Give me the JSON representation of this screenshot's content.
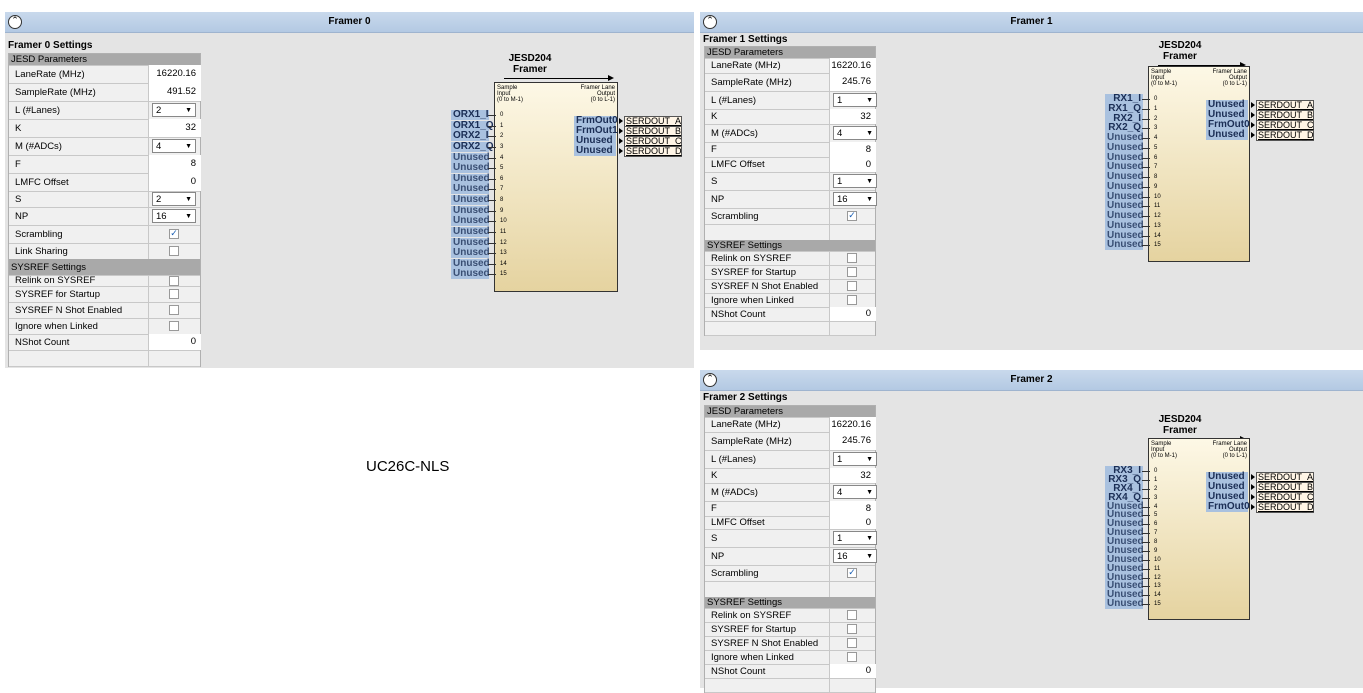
{
  "label": "UC26C-NLS",
  "rows_common": [
    "JESD Parameters",
    "LaneRate (MHz)",
    "SampleRate (MHz)",
    "L (#Lanes)",
    "K",
    "M (#ADCs)",
    "F",
    "LMFC Offset",
    "S",
    "NP",
    "Scrambling"
  ],
  "jesd_title": [
    "JESD204",
    "Framer"
  ],
  "box_header": {
    "left": "Sample\nInput\n(0 to M-1)",
    "right": "Framer Lane\nOutput\n(0 to L-1)"
  },
  "serdout": [
    "SERDOUT_A",
    "SERDOUT_B",
    "SERDOUT_C",
    "SERDOUT_D"
  ],
  "framers": [
    {
      "title": "Framer 0",
      "settings_title": "Framer 0 Settings",
      "params": {
        "lanerate": "16220.16",
        "samplerate": "491.52",
        "L": "2",
        "K": "32",
        "M": "4",
        "F": "8",
        "lmfc": "0",
        "S": "2",
        "NP": "16"
      },
      "scrambling": true,
      "link_sharing_label": "Link Sharing",
      "link_sharing": false,
      "sysref": {
        "section": "SYSREF Settings",
        "relink": "Relink on SYSREF",
        "startup": "SYSREF for Startup",
        "nshot_enabled": "SYSREF N Shot Enabled",
        "ignore": "Ignore when Linked",
        "nshot_count_label": "NShot Count",
        "nshot_count": "0"
      },
      "inputs": [
        "ORX1_I",
        "ORX1_Q",
        "ORX2_I",
        "ORX2_Q",
        "Unused",
        "Unused",
        "Unused",
        "Unused",
        "Unused",
        "Unused",
        "Unused",
        "Unused",
        "Unused",
        "Unused",
        "Unused",
        "Unused"
      ],
      "outputs": [
        "FrmOut0",
        "FrmOut1",
        "Unused",
        "Unused"
      ]
    },
    {
      "title": "Framer 1",
      "settings_title": "Framer 1 Settings",
      "params": {
        "lanerate": "16220.16",
        "samplerate": "245.76",
        "L": "1",
        "K": "32",
        "M": "4",
        "F": "8",
        "lmfc": "0",
        "S": "1",
        "NP": "16"
      },
      "scrambling": true,
      "sysref": {
        "section": "SYSREF Settings",
        "relink": "Relink on SYSREF",
        "startup": "SYSREF for Startup",
        "nshot_enabled": "SYSREF N Shot Enabled",
        "ignore": "Ignore when Linked",
        "nshot_count_label": "NShot Count",
        "nshot_count": "0"
      },
      "inputs": [
        "RX1_I",
        "RX1_Q",
        "RX2_I",
        "RX2_Q",
        "Unused",
        "Unused",
        "Unused",
        "Unused",
        "Unused",
        "Unused",
        "Unused",
        "Unused",
        "Unused",
        "Unused",
        "Unused",
        "Unused"
      ],
      "outputs": [
        "Unused",
        "Unused",
        "FrmOut0",
        "Unused"
      ]
    },
    {
      "title": "Framer 2",
      "settings_title": "Framer 2 Settings",
      "params": {
        "lanerate": "16220.16",
        "samplerate": "245.76",
        "L": "1",
        "K": "32",
        "M": "4",
        "F": "8",
        "lmfc": "0",
        "S": "1",
        "NP": "16"
      },
      "scrambling": true,
      "sysref": {
        "section": "SYSREF Settings",
        "relink": "Relink on SYSREF",
        "startup": "SYSREF for Startup",
        "nshot_enabled": "SYSREF N Shot Enabled",
        "ignore": "Ignore when Linked",
        "nshot_count_label": "NShot Count",
        "nshot_count": "0"
      },
      "inputs": [
        "RX3_I",
        "RX3_Q",
        "RX4_I",
        "RX4_Q",
        "Unused",
        "Unused",
        "Unused",
        "Unused",
        "Unused",
        "Unused",
        "Unused",
        "Unused",
        "Unused",
        "Unused",
        "Unused",
        "Unused"
      ],
      "outputs": [
        "Unused",
        "Unused",
        "Unused",
        "FrmOut0"
      ]
    }
  ]
}
